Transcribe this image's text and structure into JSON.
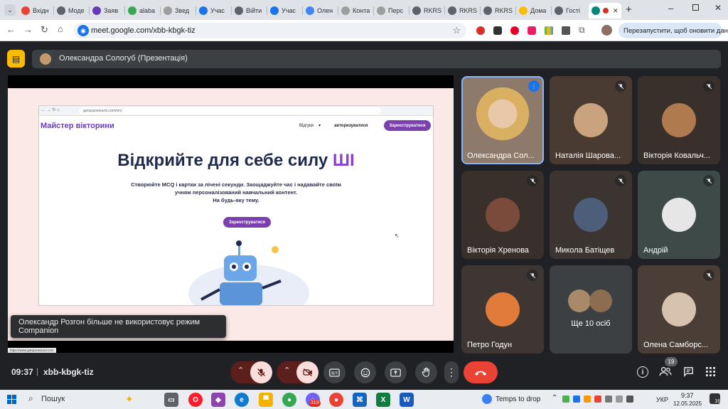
{
  "browser": {
    "tabs": [
      {
        "label": "Вхідн",
        "color": "#ea4335"
      },
      {
        "label": "Моде",
        "color": "#5f6368"
      },
      {
        "label": "Заяв",
        "color": "#673ab7"
      },
      {
        "label": "alaba",
        "color": "#34a853"
      },
      {
        "label": "Звед",
        "color": "#9e9e9e"
      },
      {
        "label": "Учас",
        "color": "#1a73e8"
      },
      {
        "label": "Війти",
        "color": "#5f6368"
      },
      {
        "label": "Учас",
        "color": "#1a73e8"
      },
      {
        "label": "Олен",
        "color": "#4285f4"
      },
      {
        "label": "Конта",
        "color": "#9e9e9e"
      },
      {
        "label": "Перс",
        "color": "#9e9e9e"
      },
      {
        "label": "RKRS",
        "color": "#5f6368"
      },
      {
        "label": "RKRS",
        "color": "#5f6368"
      },
      {
        "label": "RKRS",
        "color": "#5f6368"
      },
      {
        "label": "Дома",
        "color": "#fbbc04"
      },
      {
        "label": "Гості",
        "color": "#5f6368"
      }
    ],
    "url": "meet.google.com/xbb-kbgk-tiz",
    "restart_label": "Перезапустити, щоб оновити дані"
  },
  "meet": {
    "presenter_label": "Олександра Сологуб (Презентація)",
    "slide": {
      "inner_url": "getquizwizard.com/en/",
      "logo": "Майстер вікторини",
      "nav_reviews": "Відгуки",
      "nav_login": "авторизуватися",
      "nav_signup": "Зареєструватися",
      "headline": "Відкрийте для себе силу",
      "headline_accent": "ШІ",
      "subtext_line1": "Створюйте MCQ і картки за лічені секунди. Заощаджуйте час і надавайте своїм",
      "subtext_line2": "учням персоналізований навчальний контент.",
      "subtext_line3": "На будь-яку тему.",
      "cta": "Зареєструватися",
      "status_url": "https://www.getquizwizard.com"
    },
    "toast": "Олександр Розгон більше не використовує режим Companion",
    "participants": [
      {
        "name": "Олександра Сол...",
        "muted": false,
        "speaking": true
      },
      {
        "name": "Наталія Шарова...",
        "muted": true
      },
      {
        "name": "Вікторія Ковальч...",
        "muted": true
      },
      {
        "name": "Вікторія Хренова",
        "muted": true
      },
      {
        "name": "Микола Батіщев",
        "muted": true
      },
      {
        "name": "Андрій",
        "muted": true
      },
      {
        "name": "Петро Годун",
        "muted": true
      },
      {
        "name": "Ще 10 осіб",
        "muted": false
      },
      {
        "name": "Олена Самборс...",
        "muted": true
      }
    ],
    "time": "09:37",
    "meeting_code": "xbb-kbgk-tiz",
    "participant_count": "19"
  },
  "taskbar": {
    "search": "Пошук",
    "weather": "Temps to drop",
    "lang": "УКР",
    "clock_time": "9:37",
    "clock_date": "12.05.2025",
    "notif_count": "16",
    "badge_count": "319"
  }
}
